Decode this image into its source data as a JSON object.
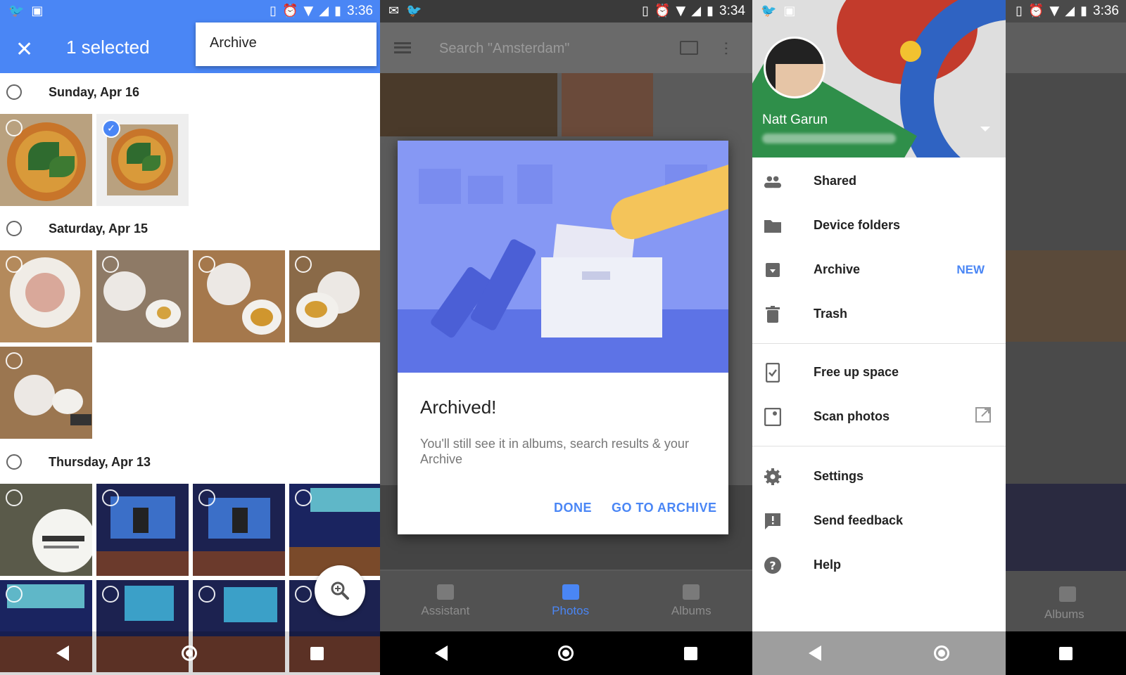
{
  "panel1": {
    "status_time": "3:36",
    "selection_title": "1 selected",
    "overflow_menu_item": "Archive",
    "groups": [
      {
        "date": "Sunday, Apr 16"
      },
      {
        "date": "Saturday, Apr 15"
      },
      {
        "date": "Thursday, Apr 13"
      }
    ],
    "zoom_icon": "zoom-in-icon"
  },
  "panel2": {
    "status_time": "3:34",
    "search_placeholder": "Search \"Amsterdam\"",
    "dialog": {
      "title": "Archived!",
      "body": "You'll still see it in albums, search results & your Archive",
      "done_label": "DONE",
      "go_label": "GO TO ARCHIVE"
    },
    "tabs": [
      {
        "label": "Assistant",
        "icon": "assistant-icon"
      },
      {
        "label": "Photos",
        "icon": "photos-icon"
      },
      {
        "label": "Albums",
        "icon": "albums-icon"
      }
    ]
  },
  "panel3": {
    "status_time": "3:36",
    "user_name": "Natt Garun",
    "menu": [
      {
        "label": "Shared",
        "icon": "people-icon"
      },
      {
        "label": "Device folders",
        "icon": "folder-icon"
      },
      {
        "label": "Archive",
        "icon": "archive-icon",
        "badge": "NEW"
      },
      {
        "label": "Trash",
        "icon": "trash-icon"
      },
      {
        "label": "Free up space",
        "icon": "phone-check-icon"
      },
      {
        "label": "Scan photos",
        "icon": "scan-icon"
      },
      {
        "label": "Settings",
        "icon": "gear-icon"
      },
      {
        "label": "Send feedback",
        "icon": "feedback-icon"
      },
      {
        "label": "Help",
        "icon": "help-icon"
      }
    ],
    "bg_tab_label": "Albums"
  },
  "colors": {
    "accent": "#4a86f5",
    "dialog_illustration": "#8698f4"
  }
}
